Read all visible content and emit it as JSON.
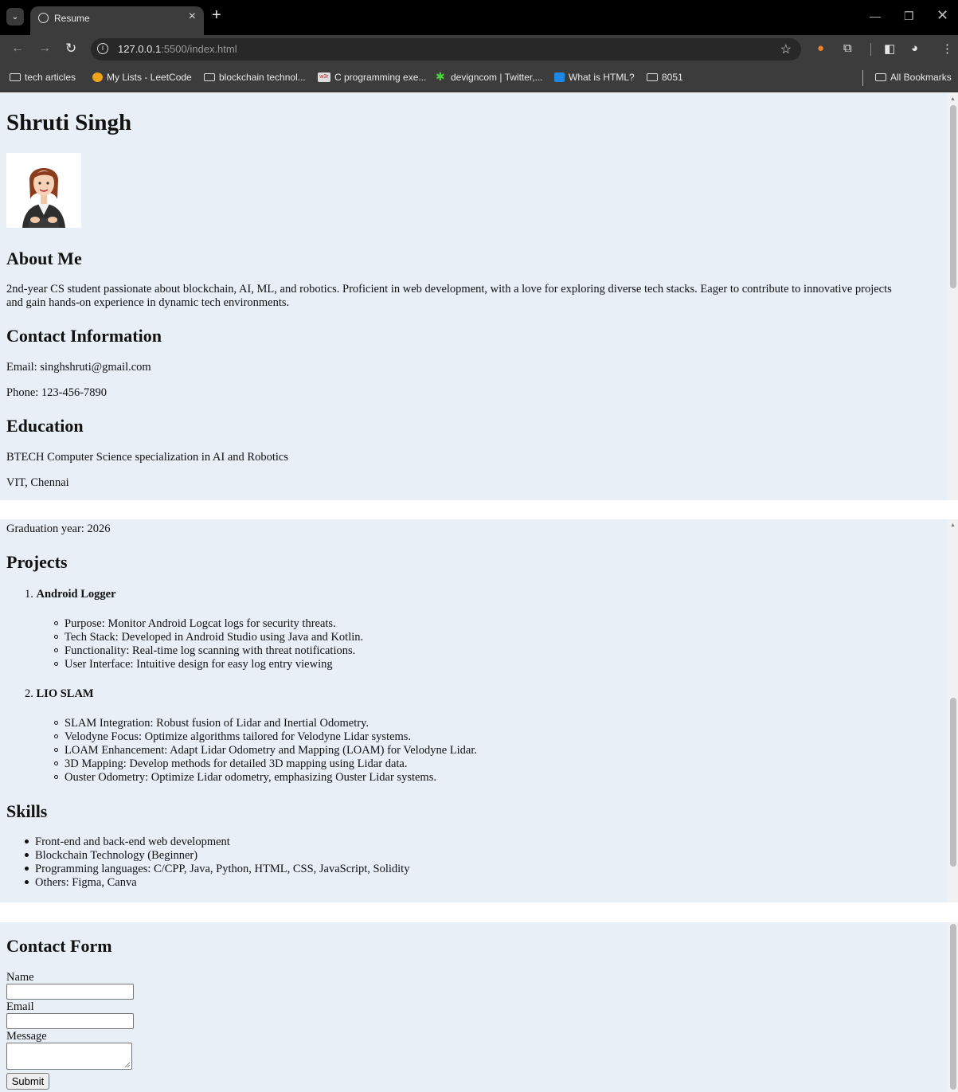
{
  "browser": {
    "tab_title": "Resume",
    "url_host": "127.0.0.1",
    "url_rest": ":5500/index.html",
    "bookmarks": [
      "tech articles",
      "My Lists - LeetCode",
      "blockchain technol...",
      "C programming exe...",
      "devigncom | Twitter,...",
      "What is HTML?",
      "8051"
    ],
    "all_bookmarks": "All Bookmarks",
    "w3_icon_text": "w3r"
  },
  "resume": {
    "name": "Shruti Singh",
    "about_heading": "About Me",
    "about_line1": "2nd-year CS student passionate about blockchain, AI, ML, and robotics. Proficient in web development, with a love for exploring diverse tech stacks. Eager to contribute to innovative projects",
    "about_line2": "and gain hands-on experience in dynamic tech environments.",
    "contact_heading": "Contact Information",
    "email": "Email: singhshruti@gmail.com",
    "phone": "Phone: 123-456-7890",
    "education_heading": "Education",
    "degree": "BTECH Computer Science specialization in AI and Robotics",
    "college": "VIT, Chennai",
    "graduation": "Graduation year: 2026",
    "projects_heading": "Projects",
    "projects": [
      {
        "number": "1.",
        "title": "Android Logger",
        "points": [
          "Purpose: Monitor Android Logcat logs for security threats.",
          "Tech Stack: Developed in Android Studio using Java and Kotlin.",
          "Functionality: Real-time log scanning with threat notifications.",
          "User Interface: Intuitive design for easy log entry viewing"
        ]
      },
      {
        "number": "2.",
        "title": "LIO SLAM",
        "points": [
          "SLAM Integration: Robust fusion of Lidar and Inertial Odometry.",
          "Velodyne Focus: Optimize algorithms tailored for Velodyne Lidar systems.",
          "LOAM Enhancement: Adapt Lidar Odometry and Mapping (LOAM) for Velodyne Lidar.",
          "3D Mapping: Develop methods for detailed 3D mapping using Lidar data.",
          "Ouster Odometry: Optimize Lidar odometry, emphasizing Ouster Lidar systems."
        ]
      }
    ],
    "skills_heading": "Skills",
    "skills": [
      "Front-end and back-end web development",
      "Blockchain Technology (Beginner)",
      "Programming languages: C/CPP, Java, Python, HTML, CSS, JavaScript, Solidity",
      "Others: Figma, Canva"
    ]
  },
  "form": {
    "heading": "Contact Form",
    "name_label": "Name",
    "email_label": "Email",
    "message_label": "Message",
    "submit_label": "Submit"
  }
}
